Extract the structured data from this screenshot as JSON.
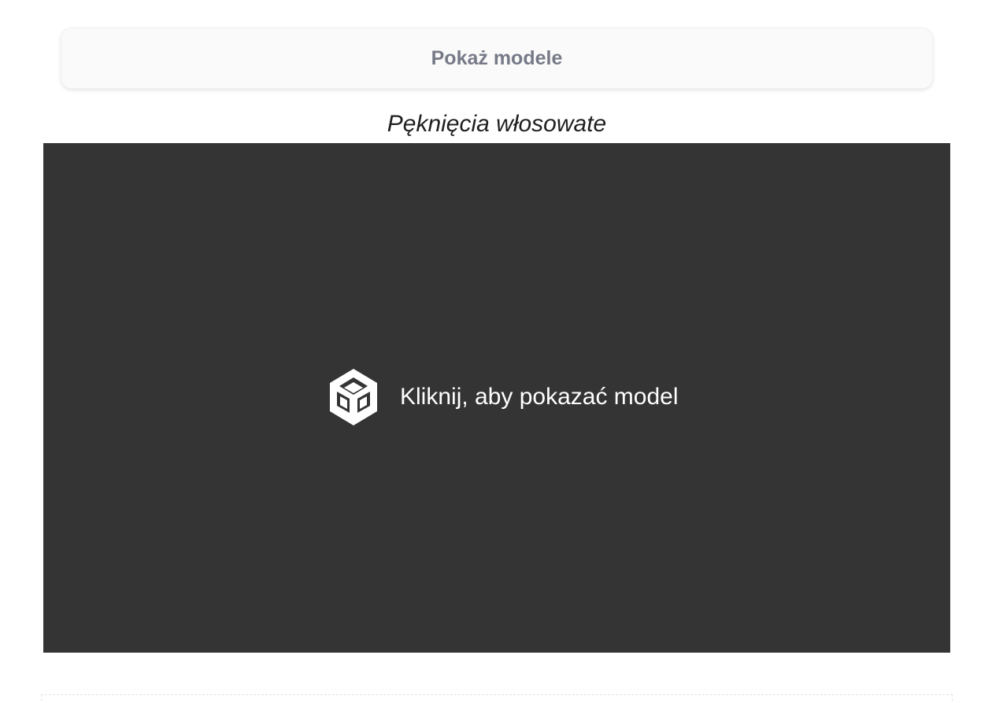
{
  "buttons": {
    "show_models_label": "Pokaż modele"
  },
  "model": {
    "title": "Pęknięcia włosowate",
    "prompt": "Kliknij, aby pokazać model",
    "icon": "unity-logo-icon"
  },
  "colors": {
    "viewer_background": "#343434",
    "button_background": "#fafafa",
    "button_text": "#777a87"
  }
}
